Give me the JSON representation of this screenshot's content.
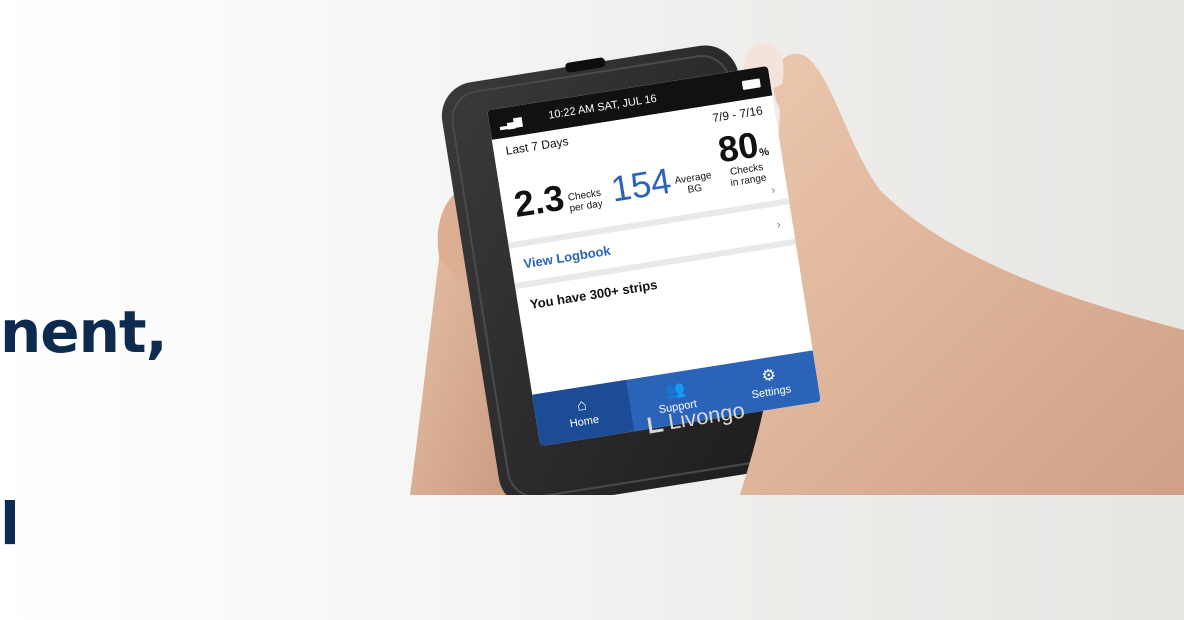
{
  "headline": {
    "line1": "nent,",
    "line2": "l"
  },
  "device": {
    "status_bar": {
      "time": "10:22 AM",
      "date": "SAT, JUL 16"
    },
    "summary": {
      "period_label": "Last 7 Days",
      "date_range": "7/9 - 7/16",
      "checks_per_day": {
        "value": "2.3",
        "label1": "Checks",
        "label2": "per day"
      },
      "average_bg": {
        "value": "154",
        "label1": "Average",
        "label2": "BG"
      },
      "checks_in_range": {
        "value": "80",
        "unit": "%",
        "label1": "Checks",
        "label2": "in range"
      }
    },
    "rows": {
      "logbook": "View Logbook",
      "strips": "You have 300+ strips"
    },
    "nav": {
      "home": "Home",
      "support": "Support",
      "settings": "Settings"
    },
    "brand": "Livongo"
  },
  "colors": {
    "headline": "#0d2a4f",
    "accent_blue": "#2a63b8",
    "device_body": "#2a2a2c"
  },
  "icons": {
    "home": "home-icon",
    "support": "support-icon",
    "settings": "gear-icon",
    "signal": "signal-icon",
    "battery": "battery-icon"
  }
}
